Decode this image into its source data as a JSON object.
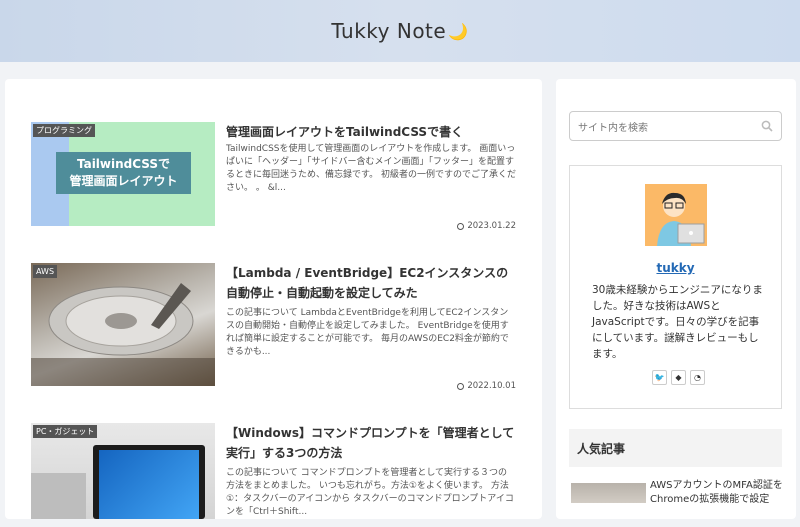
{
  "site": {
    "title": "Tukky Note",
    "moon_glyph": "🌙"
  },
  "entries": [
    {
      "category": "プログラミング",
      "title": "管理画面レイアウトをTailwindCSSで書く",
      "thumb_text": "TailwindCSSで\n管理画面レイアウト",
      "snippet": "TailwindCSSを使用して管理画面のレイアウトを作成します。 画面いっぱいに「ヘッダー」「サイドバー含むメイン画面」「フッター」を配置するときに毎回迷うため、備忘録です。 初級者の一例ですのでご了承ください。 。 &l...",
      "date": "2023.01.22"
    },
    {
      "category": "AWS",
      "title": "【Lambda / EventBridge】EC2インスタンスの自動停止・自動起動を設定してみた",
      "snippet": "この記事について LambdaとEventBridgeを利用してEC2インスタンスの自動開始・自動停止を設定してみました。 EventBridgeを使用すれば簡単に設定することが可能です。 毎月のAWSのEC2料金が節約できるかも...",
      "date": "2022.10.01"
    },
    {
      "category": "PC・ガジェット",
      "title": "【Windows】コマンドプロンプトを「管理者として実行」する3つの方法",
      "snippet": "この記事について コマンドプロンプトを管理者として実行する３つの方法をまとめました。 いつも忘れがち。方法①をよく使います。 方法①：タスクバーのアイコンから タスクバーのコマンドプロンプトアイコンを「Ctrl＋Shift..."
    }
  ],
  "sidebar": {
    "search_placeholder": "サイト内を検索",
    "profile": {
      "name": "tukky",
      "bio": "30歳未経験からエンジニアになりました。好きな技術はAWSとJavaScriptです。日々の学びを記事にしています。謎解きレビューもします。",
      "social": [
        "twitter-icon",
        "feedly-icon",
        "rss-icon"
      ]
    },
    "popular": {
      "heading": "人気記事",
      "first_item": "AWSアカウントのMFA認証をChromeの拡張機能で設定"
    }
  }
}
